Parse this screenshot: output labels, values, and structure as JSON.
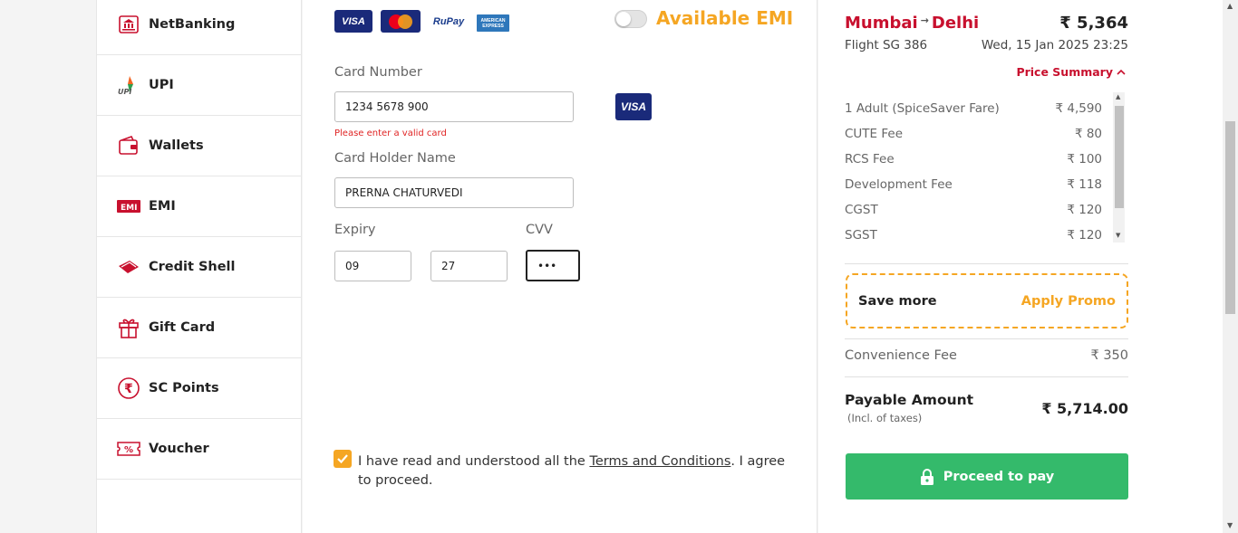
{
  "nav": {
    "items": [
      {
        "label": "NetBanking",
        "icon": "bank-icon"
      },
      {
        "label": "UPI",
        "icon": "upi-icon"
      },
      {
        "label": "Wallets",
        "icon": "wallet-icon"
      },
      {
        "label": "EMI",
        "icon": "emi-icon"
      },
      {
        "label": "Credit Shell",
        "icon": "credit-shell-icon"
      },
      {
        "label": "Gift Card",
        "icon": "gift-icon"
      },
      {
        "label": "SC Points",
        "icon": "rupee-icon"
      },
      {
        "label": "Voucher",
        "icon": "voucher-icon"
      }
    ]
  },
  "form": {
    "card_logos": [
      "VISA",
      "MasterCard",
      "RuPay",
      "AMERICAN EXPRESS"
    ],
    "emi_label": "Available EMI",
    "card_number_label": "Card Number",
    "card_number_value": "1234 5678 900",
    "card_number_error": "Please enter a valid card",
    "detected_brand": "VISA",
    "holder_label": "Card Holder Name",
    "holder_value": "PRERNA CHATURVEDI",
    "expiry_label": "Expiry",
    "expiry_month": "09",
    "expiry_year": "27",
    "cvv_label": "CVV",
    "cvv_value": "•••",
    "terms_prefix": "I have read and understood all the ",
    "terms_link": "Terms and Conditions",
    "terms_suffix": ". I agree to proceed."
  },
  "summary": {
    "origin": "Mumbai",
    "destination": "Delhi",
    "price": "₹ 5,364",
    "flight": "Flight  SG 386",
    "datetime": "Wed, 15 Jan 2025 23:25",
    "price_summary_label": "Price Summary",
    "fares": [
      {
        "label": "1 Adult  (SpiceSaver Fare)",
        "amount": "₹ 4,590"
      },
      {
        "label": "CUTE Fee",
        "amount": "₹ 80"
      },
      {
        "label": "RCS Fee",
        "amount": "₹ 100"
      },
      {
        "label": "Development Fee",
        "amount": "₹ 118"
      },
      {
        "label": "CGST",
        "amount": "₹ 120"
      },
      {
        "label": "SGST",
        "amount": "₹ 120"
      }
    ],
    "promo_text": "Save more",
    "promo_action": "Apply Promo",
    "convenience_label": "Convenience Fee",
    "convenience_amount": "₹ 350",
    "payable_label": "Payable Amount",
    "payable_note": "(Incl. of taxes)",
    "payable_amount": "₹ 5,714.00",
    "proceed_label": "Proceed to pay"
  },
  "colors": {
    "brand_red": "#c8102e",
    "accent_orange": "#f5a623",
    "pay_green": "#34ba6b"
  }
}
